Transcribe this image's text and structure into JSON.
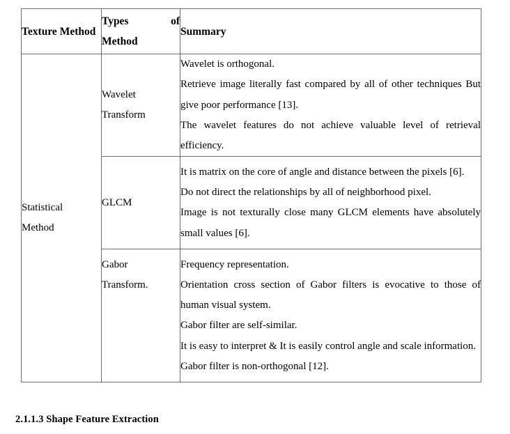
{
  "table": {
    "headers": [
      {
        "line1": "Texture",
        "line2": "Method"
      },
      {
        "line1": "Types of",
        "line2": "Method"
      },
      {
        "line1": "Summary",
        "line2": ""
      }
    ],
    "method_group_label_line1": "Statistical",
    "method_group_label_line2": "Method",
    "rows": [
      {
        "type_line1": "Wavelet",
        "type_line2": "Transform",
        "summary": [
          "Wavelet is orthogonal.",
          "Retrieve image literally fast compared by all of other techniques But give poor performance [13].",
          "The wavelet features do not achieve valuable level of retrieval efficiency."
        ]
      },
      {
        "type_line1": "GLCM",
        "type_line2": "",
        "summary": [
          "It is matrix on the core of angle and distance between the pixels [6].",
          "Do not direct the relationships by all of neighborhood pixel.",
          "Image is not texturally close many GLCM elements have absolutely small values [6]."
        ]
      },
      {
        "type_line1": "Gabor",
        "type_line2": "Transform.",
        "summary": [
          "Frequency representation.",
          "Orientation cross section of Gabor filters is evocative to those of human visual system.",
          "Gabor filter are self-similar.",
          "It is easy to interpret & It is easily control angle and scale information.",
          "Gabor filter is non-orthogonal [12]."
        ]
      }
    ]
  },
  "section_heading": "2.1.1.3 Shape Feature Extraction"
}
